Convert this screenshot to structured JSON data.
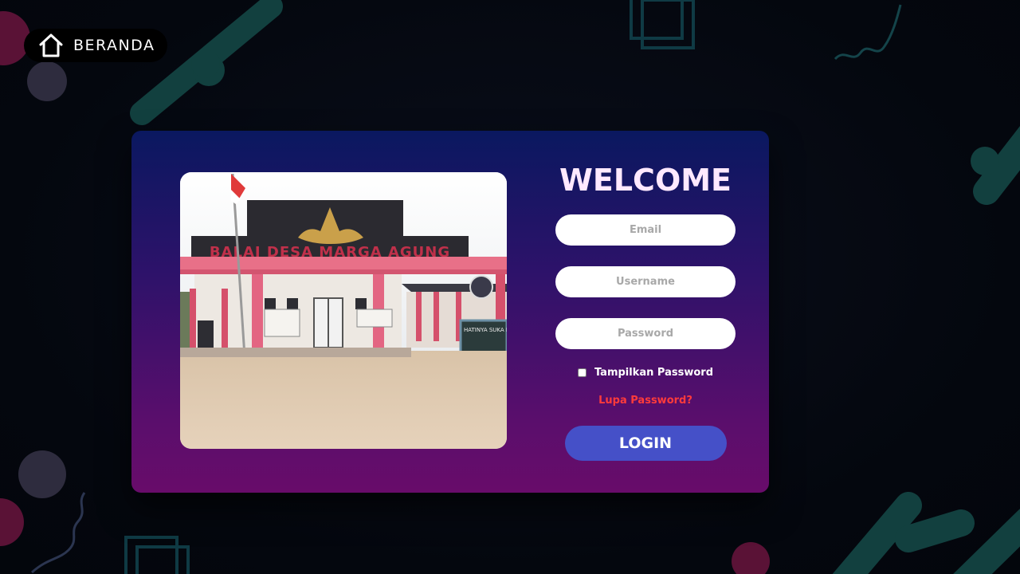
{
  "home": {
    "label": "BERANDA",
    "icon": "home-icon"
  },
  "login_form": {
    "title": "WELCOME",
    "email_placeholder": "Email",
    "username_placeholder": "Username",
    "password_placeholder": "Password",
    "show_password_label": "Tampilkan Password",
    "forgot_password_label": "Lupa Password?",
    "login_button_label": "LOGIN"
  },
  "photo": {
    "building_sign": "BALAI DESA MARGA AGUNG",
    "board_text": "HATINYA SUKA PKK"
  },
  "colors": {
    "accent": "#4550c8",
    "forgot_link": "#ff3b3b",
    "title": "#ffe9ff",
    "background": "#050a14",
    "card_top": "#0a1860",
    "card_bottom": "#680c6a"
  }
}
